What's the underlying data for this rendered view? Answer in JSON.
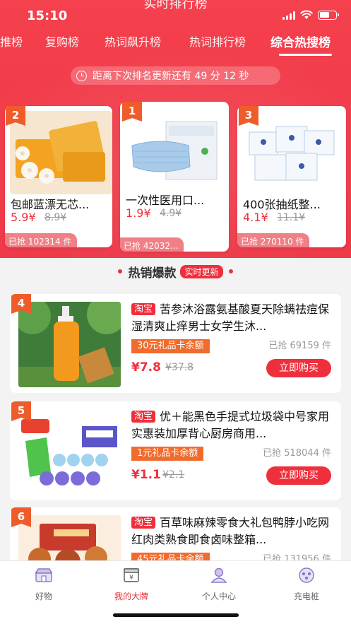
{
  "statusbar": {
    "time": "15:10"
  },
  "page_title": "实时排行榜",
  "tabs": [
    {
      "label": "推榜"
    },
    {
      "label": "复购榜"
    },
    {
      "label": "热词飙升榜"
    },
    {
      "label": "热词排行榜"
    },
    {
      "label": "综合热搜榜"
    }
  ],
  "active_tab": "综合热搜榜",
  "countdown": {
    "text": "距离下次排名更新还有 49 分 12 秒"
  },
  "top3": [
    {
      "rank": "2",
      "name": "包邮蓝漂无芯...",
      "price": "5.9¥",
      "old_price": "8.9¥",
      "sold": "已抢 102314 件"
    },
    {
      "rank": "1",
      "name": "一次性医用口...",
      "price": "1.9¥",
      "old_price": "4.9¥",
      "sold": "已抢 42032..."
    },
    {
      "rank": "3",
      "name": "400张抽纸整...",
      "price": "4.1¥",
      "old_price": "11.1¥",
      "sold": "已抢 270110 件"
    }
  ],
  "section": {
    "title": "热销爆款",
    "badge": "实时更新"
  },
  "items": [
    {
      "rank": "4",
      "platform": "淘宝",
      "title": "苦参沐浴露氨基酸夏天除螨祛痘保湿清爽止痒男士女学生沐...",
      "coupon": "30元礼品卡余额",
      "sold": "已抢 69159 件",
      "price": "¥7.8",
      "old_price": "¥37.8",
      "buy": "立即购买"
    },
    {
      "rank": "5",
      "platform": "淘宝",
      "title": "优＋能黑色手提式垃圾袋中号家用实惠装加厚背心厨房商用...",
      "coupon": "1元礼品卡余额",
      "sold": "已抢 518044 件",
      "price": "¥1.1",
      "old_price": "¥2.1",
      "buy": "立即购买"
    },
    {
      "rank": "6",
      "platform": "淘宝",
      "title": "百草味麻辣零食大礼包鸭脖小吃网红肉类熟食即食卤味整箱...",
      "coupon": "45元礼品卡余额",
      "sold": "已抢 131956 件",
      "price": "",
      "old_price": "",
      "buy": ""
    }
  ],
  "tabbar": [
    {
      "label": "好物",
      "icon": "shop-icon"
    },
    {
      "label": "我的大牌",
      "icon": "brand-icon"
    },
    {
      "label": "个人中心",
      "icon": "user-icon"
    },
    {
      "label": "充电桩",
      "icon": "charger-icon"
    }
  ],
  "active_tabbar": "我的大牌",
  "colors": {
    "brand_red": "#ef2f3c",
    "coupon_orange": "#f06b2e",
    "rank_orange": "#ef5c2b"
  }
}
